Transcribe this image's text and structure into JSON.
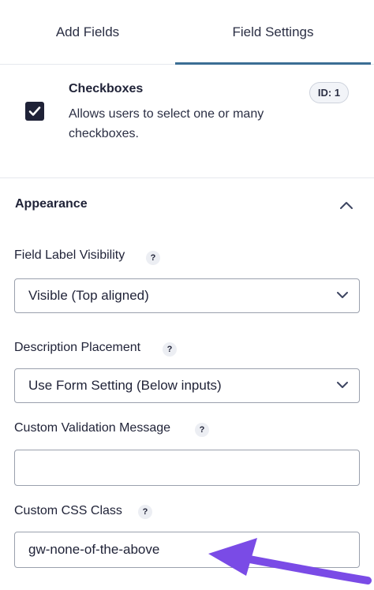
{
  "tabs": {
    "add_fields": "Add Fields",
    "field_settings": "Field Settings"
  },
  "field": {
    "title": "Checkboxes",
    "description": "Allows users to select one or many checkboxes.",
    "id_badge": "ID: 1",
    "checked": true
  },
  "appearance": {
    "title": "Appearance",
    "expanded": true
  },
  "settings": {
    "label_visibility": {
      "label": "Field Label Visibility",
      "help": "?",
      "selected": "Visible (Top aligned)"
    },
    "description_placement": {
      "label": "Description Placement",
      "help": "?",
      "selected": "Use Form Setting (Below inputs)"
    },
    "custom_validation": {
      "label": "Custom Validation Message",
      "help": "?",
      "value": ""
    },
    "custom_css": {
      "label": "Custom CSS Class",
      "help": "?",
      "value": "gw-none-of-the-above"
    }
  },
  "colors": {
    "accent_underline": "#3b6e94",
    "annotation_arrow": "#7a4be6",
    "checkbox": "#1f2237"
  },
  "icons": {
    "checkbox": "checkmark-icon",
    "collapse": "chevron-up-icon",
    "select": "chevron-down-icon",
    "annotation": "arrow-icon"
  }
}
